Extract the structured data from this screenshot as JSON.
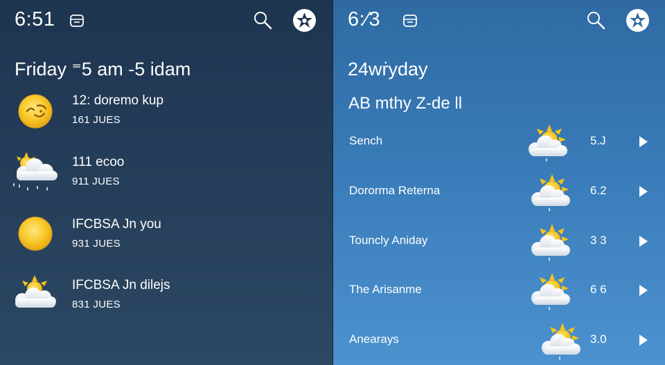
{
  "left_panel": {
    "status_time": "6:51",
    "status_icon": "calendar-icon",
    "search_icon": "search-icon",
    "avatar_icon": "profile-badge-icon",
    "headline": "Friday ⁼5 am -5 idam",
    "items": [
      {
        "title": "12: doremo kup",
        "subtitle": "161 JUES",
        "icon": "sun-face-icon"
      },
      {
        "title": "111 ecoo",
        "subtitle": "911 JUES",
        "icon": "rain-cloud-sun-icon"
      },
      {
        "title": "IFCBSA Jn you",
        "subtitle": "931 JUES",
        "icon": "sun-icon"
      },
      {
        "title": "IFCBSA Jn dilejs",
        "subtitle": "831 JUES",
        "icon": "partly-cloudy-icon"
      }
    ]
  },
  "right_panel": {
    "status_time": "6:⁄3",
    "status_icon": "calendar-icon",
    "search_icon": "search-icon",
    "avatar_icon": "profile-badge-icon",
    "headline": "24wṙyday",
    "subheadline": "AB mthy Z-de ll",
    "rows": [
      {
        "label": "Sench",
        "value": "5.J",
        "icon": "partly-cloudy-rain-icon"
      },
      {
        "label": "Dororma Reterna",
        "value": "6.2",
        "icon": "partly-cloudy-rain-icon"
      },
      {
        "label": "Touncly Aniday",
        "value": "3 3",
        "icon": "partly-cloudy-rain-icon"
      },
      {
        "label": "The Arisanme",
        "value": "6 6",
        "icon": "partly-cloudy-rain-icon"
      },
      {
        "label": "Anearays",
        "value": "3.0",
        "icon": "partly-cloudy-rain-icon"
      }
    ]
  },
  "colors": {
    "left_bg": "#1e3550",
    "right_bg": "#3a7dba",
    "sun": "#f5c11c",
    "cloud": "#f2f4f7"
  }
}
